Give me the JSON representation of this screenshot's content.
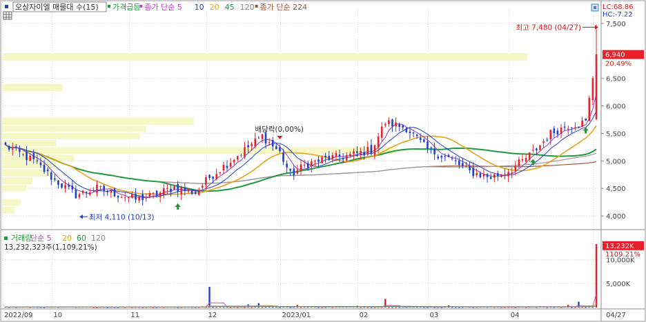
{
  "colors": {
    "up": "#e8202a",
    "down": "#1f3fd0",
    "ma5": "#8a3fd1",
    "ma20": "#e9a21a",
    "ma45": "#1f9a3c",
    "ma120": "#999999",
    "ma224": "#a5553a",
    "grid": "#d6d6d6",
    "profile": "#f5f7c6",
    "axis_text": "#444444",
    "high_label": "#d12020",
    "low_label": "#1f3fd0",
    "volume_ma5": "#d946b0",
    "volume_ma20": "#e9a21a",
    "volume_ma60": "#1f9a3c",
    "volume_ma120": "#888888"
  },
  "chart_data": [
    {
      "type": "candlestick",
      "name": "price",
      "legend": [
        {
          "text": "오상자이엘 매물대 수(15)",
          "color": "#333333",
          "boxed": true
        },
        {
          "text": "가격급등",
          "color": "#1f9a3c"
        },
        {
          "text": "종가 단순 5",
          "color": "#c040c0"
        },
        {
          "text": "10",
          "color": "#1f3fd0"
        },
        {
          "text": "20",
          "color": "#e9a21a"
        },
        {
          "text": "45",
          "color": "#1f9a3c"
        },
        {
          "text": "120",
          "color": "#888888"
        },
        {
          "text": "종가 단순 224",
          "color": "#a5553a"
        }
      ],
      "y_ticks": [
        "7,500",
        "6,500",
        "6,000",
        "5,500",
        "5,000",
        "4,500",
        "4,000"
      ],
      "ylim": [
        3750,
        7750
      ],
      "corner_labels": {
        "lc": "LC:68.86",
        "hc": "HC:-7.22"
      },
      "current_price": {
        "value": "6,940",
        "change": "20.49%",
        "price": 6940
      },
      "annotations": {
        "high": "최고 7,480 (04/27)",
        "low": "최저 4,110 (10/13)",
        "ex_dividend": "배당락(0,00%)"
      },
      "x_labels": [
        "2022/09",
        "10",
        "11",
        "12",
        "2023/01",
        "02",
        "03",
        "04",
        "04/27"
      ],
      "x_label_index": [
        0,
        14,
        36,
        58,
        79,
        101,
        121,
        144,
        168
      ],
      "n_days": 169,
      "anchors": [
        [
          0,
          5270
        ],
        [
          8,
          5000
        ],
        [
          14,
          4650
        ],
        [
          20,
          4380
        ],
        [
          26,
          4500
        ],
        [
          32,
          4390
        ],
        [
          37,
          4300
        ],
        [
          42,
          4370
        ],
        [
          48,
          4520
        ],
        [
          54,
          4420
        ],
        [
          58,
          4700
        ],
        [
          63,
          4950
        ],
        [
          68,
          5200
        ],
        [
          73,
          5450
        ],
        [
          78,
          5150
        ],
        [
          81,
          4750
        ],
        [
          86,
          4950
        ],
        [
          92,
          5050
        ],
        [
          98,
          5100
        ],
        [
          104,
          5200
        ],
        [
          108,
          5700
        ],
        [
          114,
          5600
        ],
        [
          120,
          5200
        ],
        [
          126,
          5050
        ],
        [
          132,
          4800
        ],
        [
          138,
          4700
        ],
        [
          144,
          4850
        ],
        [
          150,
          5150
        ],
        [
          155,
          5500
        ],
        [
          160,
          5650
        ],
        [
          165,
          5700
        ],
        [
          168,
          6940
        ]
      ],
      "max_wick_high": 7480,
      "ma_labels": [
        "5",
        "10",
        "20",
        "45",
        "120",
        "224"
      ],
      "signal_arrows": [
        49,
        150,
        165
      ],
      "volume_profile": [
        {
          "price_low": 6810,
          "price_high": 6960,
          "width_pct": 88
        },
        {
          "price_low": 6250,
          "price_high": 6400,
          "width_pct": 10
        },
        {
          "price_low": 5640,
          "price_high": 5790,
          "width_pct": 32
        },
        {
          "price_low": 5510,
          "price_high": 5640,
          "width_pct": 24
        },
        {
          "price_low": 5380,
          "price_high": 5510,
          "width_pct": 23
        },
        {
          "price_low": 5250,
          "price_high": 5380,
          "width_pct": 9
        },
        {
          "price_low": 5110,
          "price_high": 5250,
          "width_pct": 66
        },
        {
          "price_low": 4980,
          "price_high": 5110,
          "width_pct": 12
        },
        {
          "price_low": 4850,
          "price_high": 5000,
          "width_pct": 9
        },
        {
          "price_low": 4700,
          "price_high": 4850,
          "width_pct": 8
        },
        {
          "price_low": 4560,
          "price_high": 4700,
          "width_pct": 5
        },
        {
          "price_low": 4430,
          "price_high": 4560,
          "width_pct": 4
        },
        {
          "price_low": 4170,
          "price_high": 4310,
          "width_pct": 3
        },
        {
          "price_low": 4030,
          "price_high": 4170,
          "width_pct": 2
        }
      ]
    },
    {
      "type": "bar",
      "name": "volume",
      "legend": [
        {
          "text": "거래량",
          "color": "#1f9a3c"
        },
        {
          "text": "단순 5",
          "color": "#c040c0"
        },
        {
          "text": "20",
          "color": "#e9a21a"
        },
        {
          "text": "60",
          "color": "#1f9a3c"
        },
        {
          "text": "120",
          "color": "#888888"
        }
      ],
      "summary": "13,232,323주(1,109,21%)",
      "y_ticks": [
        "10,000K",
        "5,000K"
      ],
      "ylim": [
        0,
        14500
      ],
      "current": {
        "value": "13,232K",
        "pct": "1109.21%",
        "amount": 13232
      },
      "spikes": [
        [
          58,
          4300
        ],
        [
          56,
          250
        ],
        [
          62,
          200
        ],
        [
          69,
          650
        ],
        [
          72,
          900
        ],
        [
          75,
          220
        ],
        [
          83,
          550
        ],
        [
          100,
          350
        ],
        [
          108,
          1800
        ],
        [
          126,
          420
        ],
        [
          152,
          300
        ],
        [
          160,
          550
        ],
        [
          163,
          1200
        ],
        [
          168,
          13232
        ]
      ],
      "baseline_volume": 120
    }
  ]
}
